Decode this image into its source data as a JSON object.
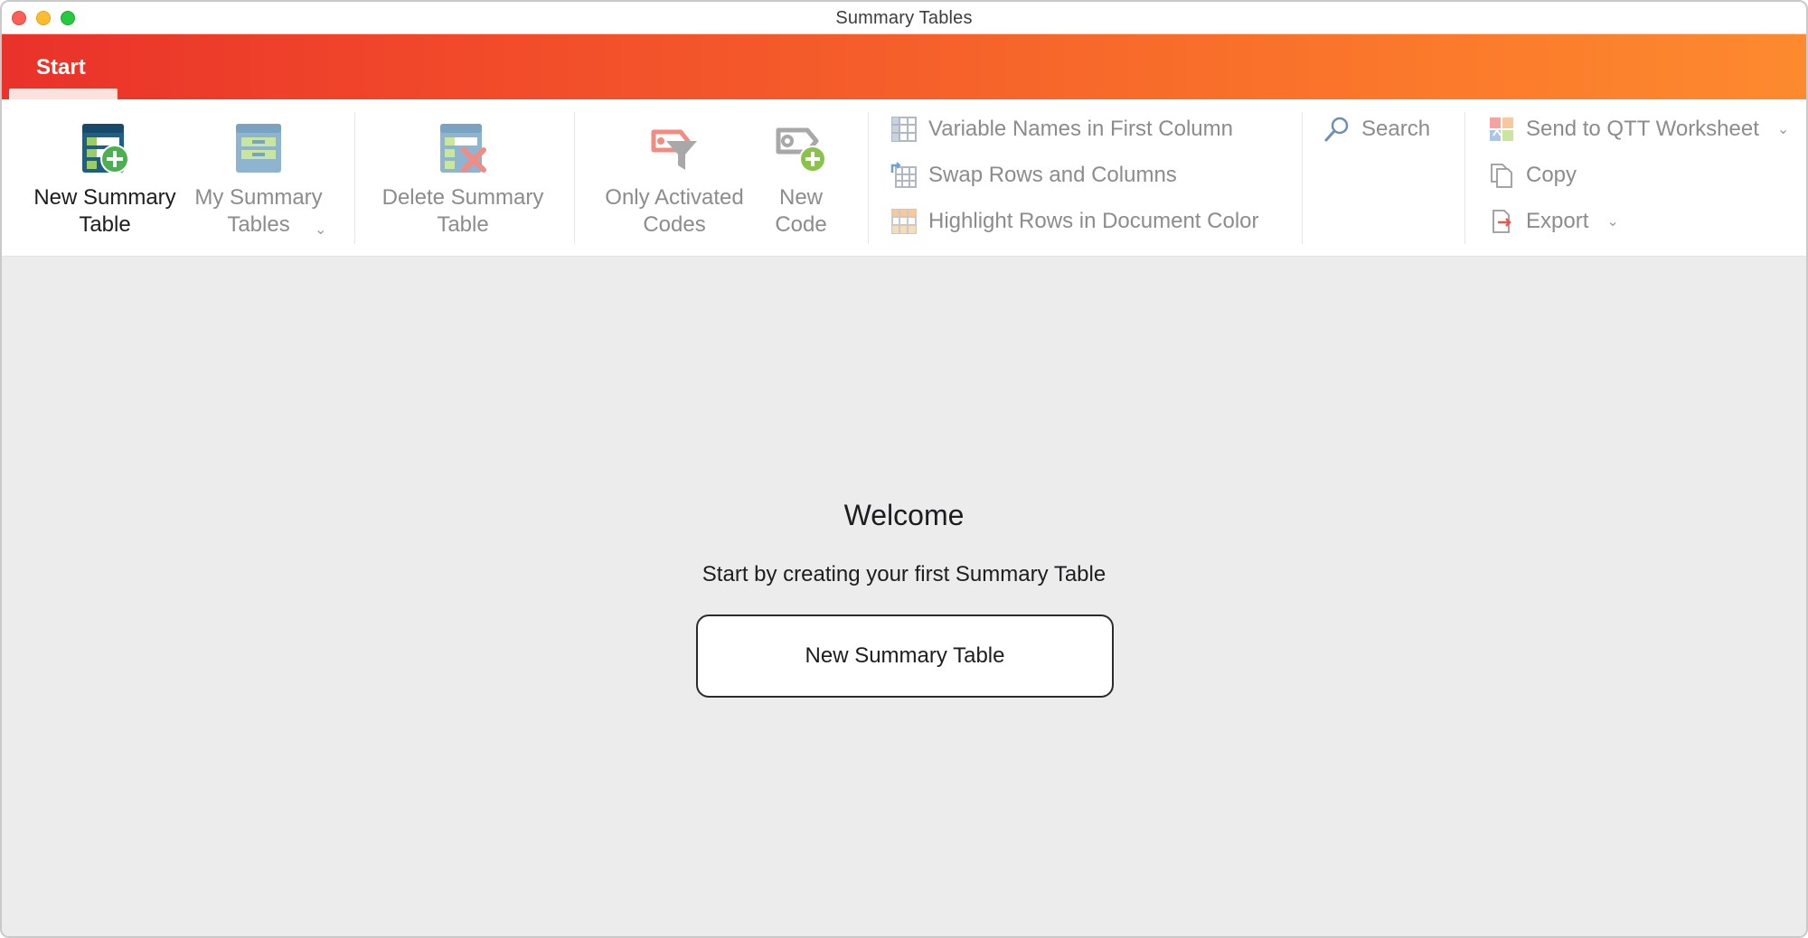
{
  "window": {
    "title": "Summary Tables"
  },
  "ribbon": {
    "tabs": [
      {
        "label": "Start",
        "active": true
      }
    ],
    "big_buttons": {
      "new_summary_table": {
        "line1": "New Summary",
        "line2": "Table",
        "enabled": true,
        "icon": "new-table-plus-icon"
      },
      "my_summary_tables": {
        "line1": "My Summary",
        "line2": "Tables",
        "enabled": false,
        "icon": "table-list-icon",
        "has_dropdown": true
      },
      "delete_summary_table": {
        "line1": "Delete Summary",
        "line2": "Table",
        "enabled": false,
        "icon": "table-delete-icon"
      },
      "only_activated_codes": {
        "line1": "Only Activated",
        "line2": "Codes",
        "enabled": false,
        "icon": "code-filter-icon"
      },
      "new_code": {
        "line1": "New",
        "line2": "Code",
        "enabled": false,
        "icon": "code-plus-icon"
      }
    },
    "options": {
      "variable_names_first_column": "Variable Names in First Column",
      "swap_rows_columns": "Swap Rows and Columns",
      "highlight_rows_document_color": "Highlight Rows in Document Color"
    },
    "search_label": "Search",
    "output": {
      "send_to_qtt": "Send to QTT Worksheet",
      "copy": "Copy",
      "export": "Export"
    }
  },
  "main": {
    "welcome_title": "Welcome",
    "welcome_subtitle": "Start by creating your first Summary Table",
    "welcome_button": "New Summary Table"
  },
  "colors": {
    "ribbon_gradient_start": "#e9322a",
    "ribbon_gradient_end": "#fd8a2f",
    "disabled_text": "#8c8c8c",
    "content_background": "#ececec"
  }
}
